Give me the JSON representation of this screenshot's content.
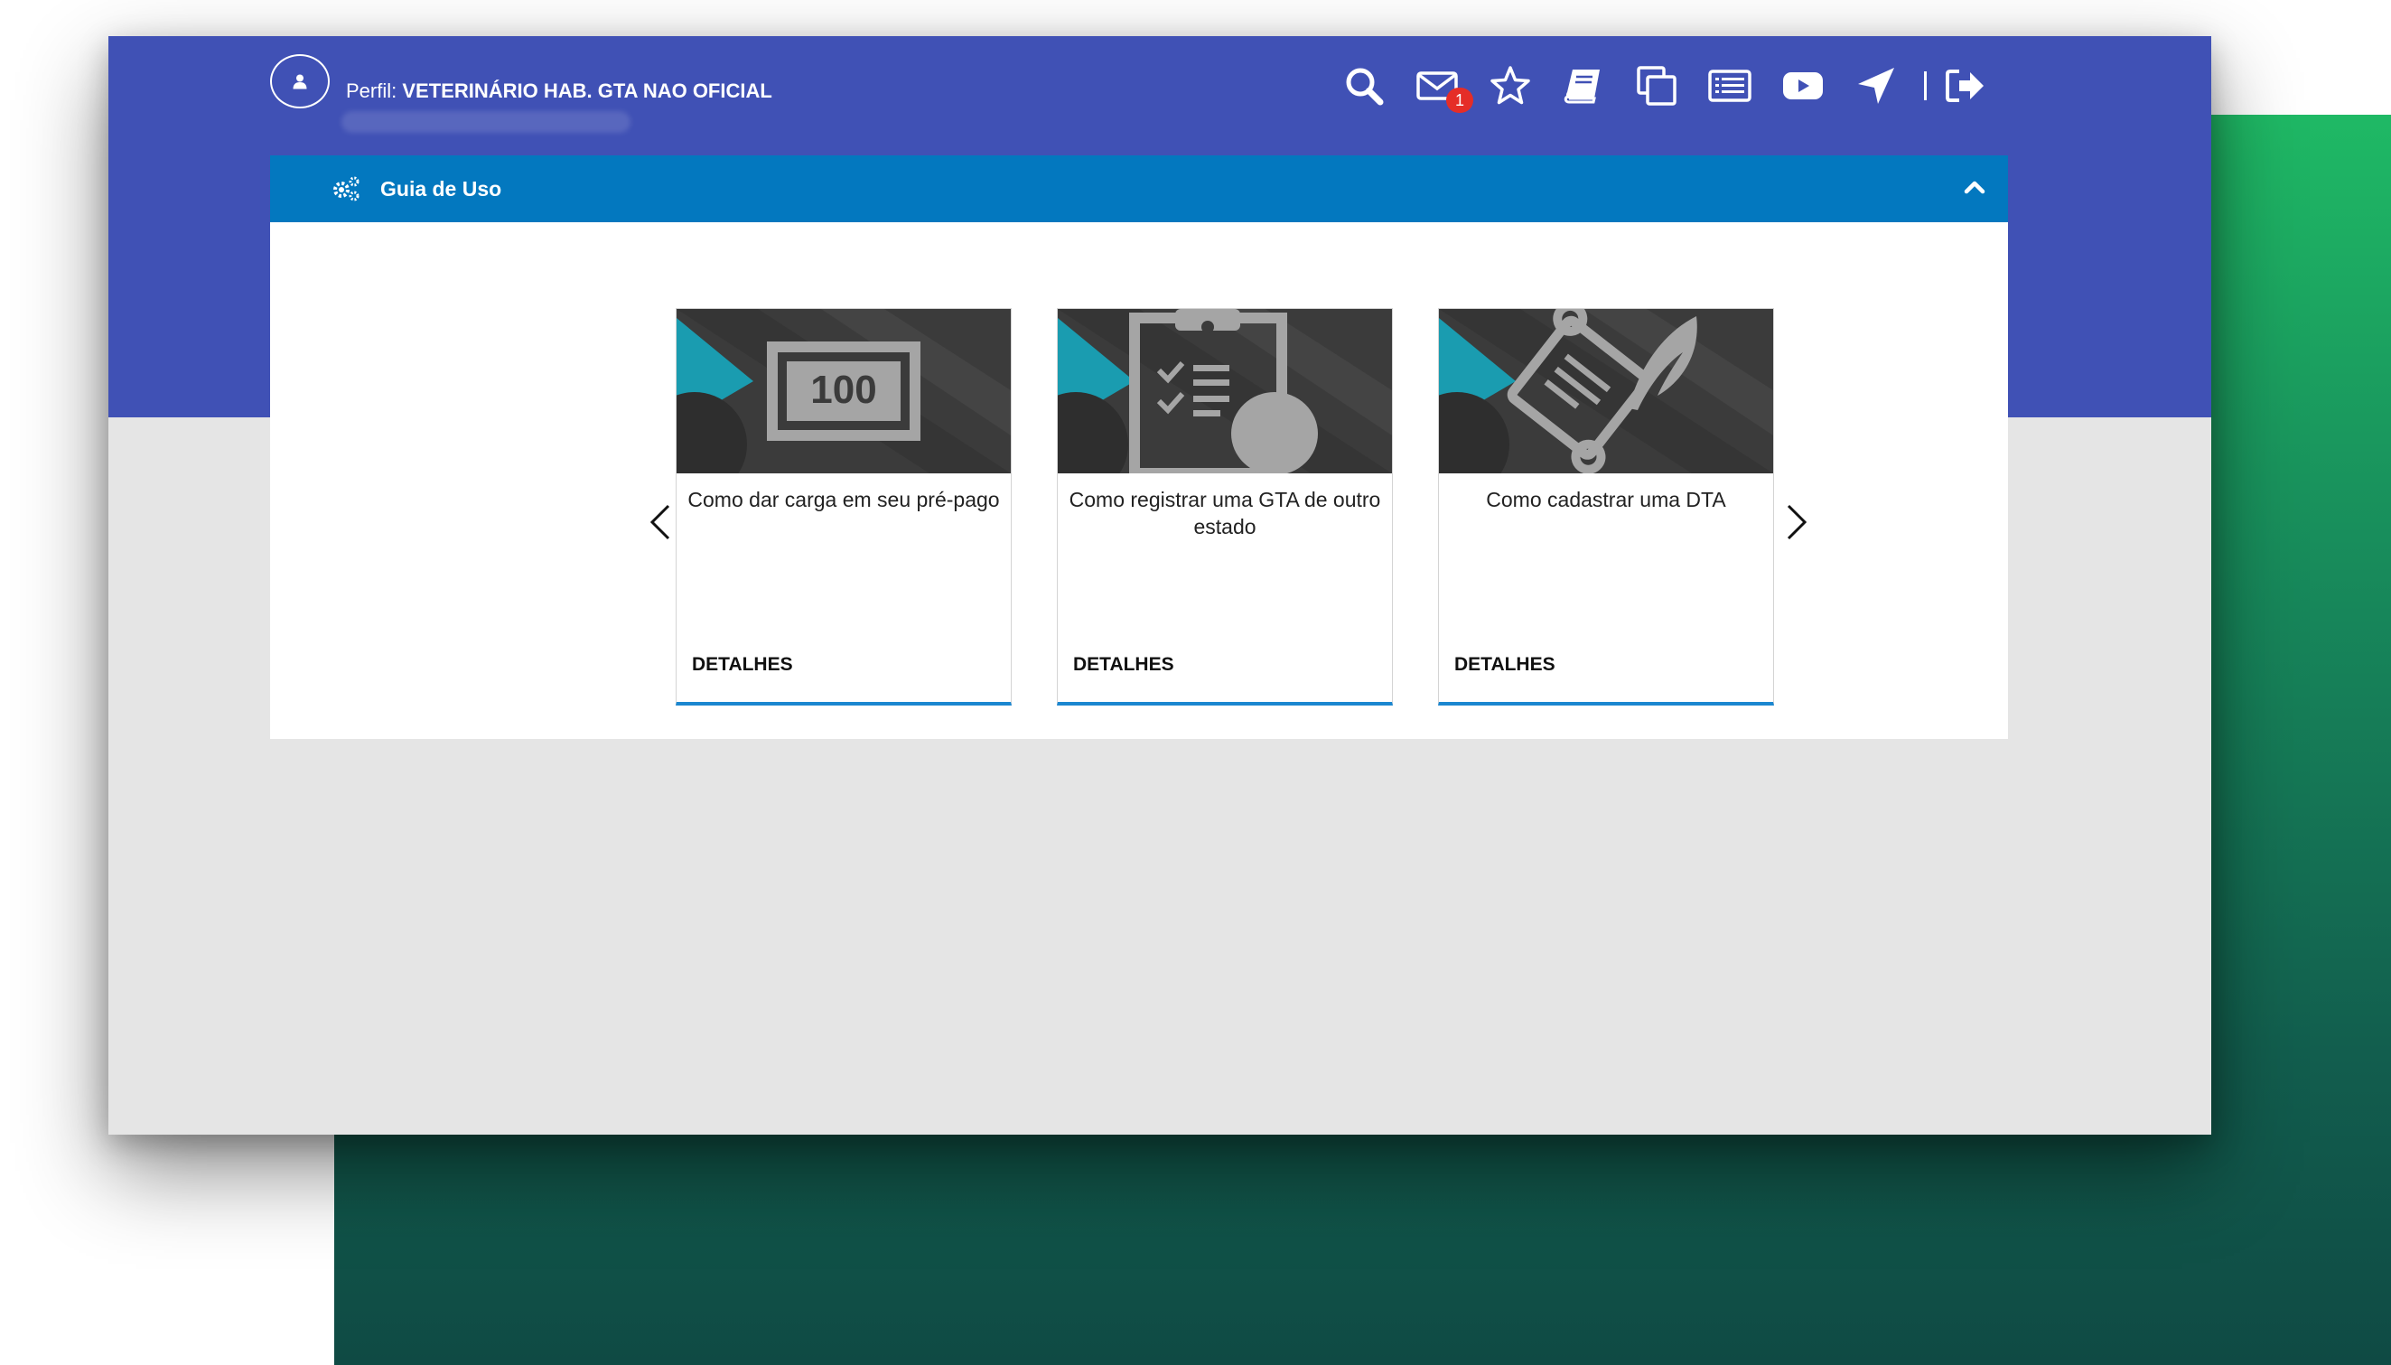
{
  "header": {
    "profile_prefix": "Perfil:",
    "profile_value": "VETERINÁRIO HAB. GTA NAO OFICIAL",
    "icons": [
      "search-icon",
      "mail-icon",
      "star-icon",
      "book-icon",
      "windows-icon",
      "list-icon",
      "youtube-icon",
      "location-arrow-icon",
      "logout-icon"
    ],
    "mail_badge": "1"
  },
  "panel": {
    "title": "Guia de Uso"
  },
  "cards": [
    {
      "title": "Como dar carga em seu pré-pago",
      "icon": "banknote-100-icon",
      "thumb_text": "100",
      "details": "DETALHES"
    },
    {
      "title": "Como registrar uma GTA de outro estado",
      "icon": "clipboard-checklist-icon",
      "details": "DETALHES"
    },
    {
      "title": "Como cadastrar uma DTA",
      "icon": "scroll-feather-icon",
      "details": "DETALHES"
    }
  ],
  "colors": {
    "header_bg": "#4051b5",
    "panel_head_bg": "#0378bf",
    "card_accent": "#1b87d0",
    "badge_bg": "#e52d27",
    "page_bg": "#e5e5e5",
    "thumb_bg": "#3b3b3b",
    "thumb_accent": "#1a9cb0"
  }
}
